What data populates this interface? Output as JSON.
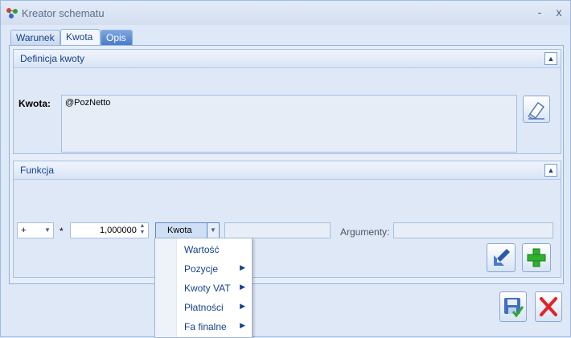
{
  "window": {
    "title": "Kreator schematu"
  },
  "titlebar_buttons": {
    "minimize": "-",
    "close": "x"
  },
  "tabs": [
    {
      "label": "Warunek"
    },
    {
      "label": "Kwota"
    },
    {
      "label": "Opis"
    }
  ],
  "definition": {
    "title": "Definicja kwoty",
    "kwota_label": "Kwota:",
    "kwota_value": "@PozNetto"
  },
  "function": {
    "title": "Funkcja",
    "operator": "+",
    "multiplier_symbol": "*",
    "factor": "1,000000",
    "source": "Kwota",
    "arguments_label": "Argumenty:"
  },
  "dropdown_menu": [
    {
      "label": "Wartość",
      "submenu": false
    },
    {
      "label": "Pozycje",
      "submenu": true
    },
    {
      "label": "Kwoty VAT",
      "submenu": true
    },
    {
      "label": "Płatności",
      "submenu": true
    },
    {
      "label": "Fa finalne",
      "submenu": true
    }
  ],
  "icons": {
    "edit": "eraser-edit-icon",
    "insert": "insert-arrow-icon",
    "add": "plus-icon",
    "save": "save-icon",
    "cancel": "cancel-icon"
  },
  "colors": {
    "accent": "#15428b",
    "add": "#2fb12f",
    "cancel": "#e0242a"
  }
}
